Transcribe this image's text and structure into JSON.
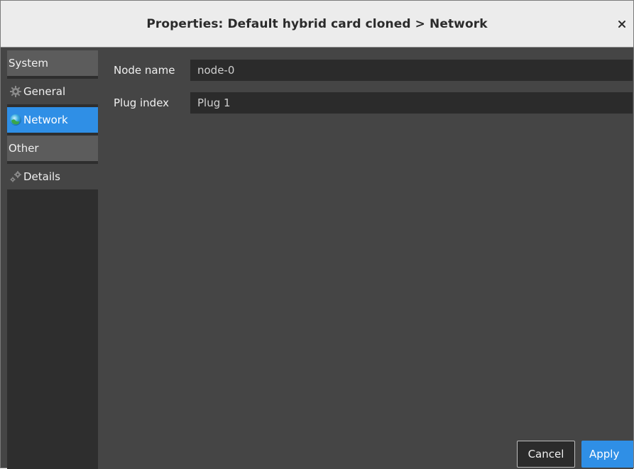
{
  "window": {
    "title": "Properties: Default hybrid card cloned > Network"
  },
  "sidebar": {
    "groups": [
      {
        "label": "System"
      },
      {
        "label": "Other"
      }
    ],
    "items": [
      {
        "label": "General",
        "icon": "gear-icon"
      },
      {
        "label": "Network",
        "icon": "globe-icon",
        "active": true
      },
      {
        "label": "Details",
        "icon": "gears-icon"
      }
    ]
  },
  "form": {
    "node_name_label": "Node name",
    "node_name_value": "node-0",
    "plug_index_label": "Plug index",
    "plug_index_value": "Plug 1"
  },
  "buttons": {
    "cancel_label": "Cancel",
    "apply_label": "Apply"
  },
  "colors": {
    "accent": "#2f8fe6",
    "background": "#454545",
    "sidebar": "#2e2e2e",
    "titlebar": "#ececec"
  }
}
